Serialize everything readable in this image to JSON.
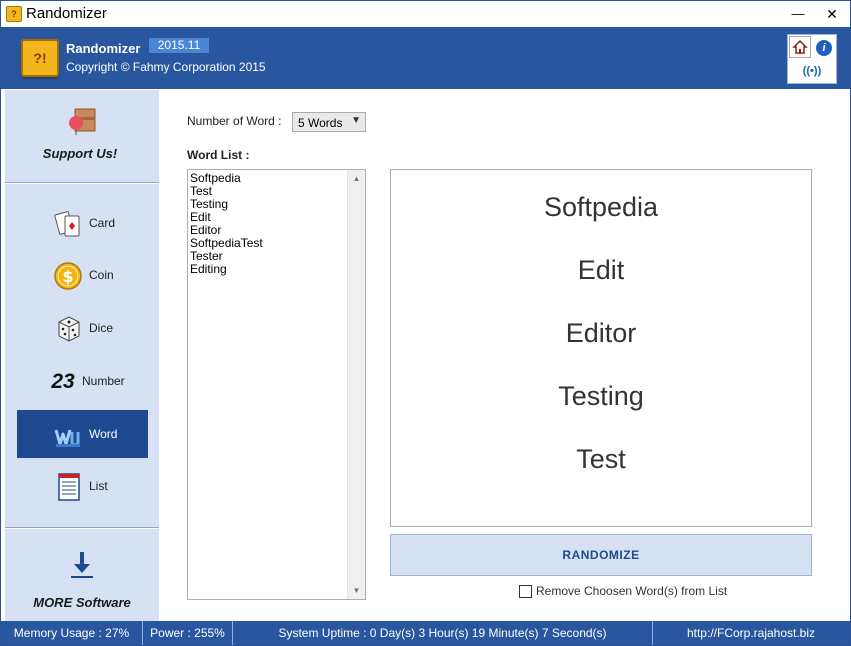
{
  "window": {
    "title": "Randomizer",
    "minimize_glyph": "—",
    "close_glyph": "✕"
  },
  "header": {
    "app_name": "Randomizer",
    "version": "2015.11",
    "copyright": "Copyright © Fahmy Corporation 2015",
    "home_icon": "home-icon",
    "info_icon": "info-icon",
    "web_icon": "web-icon"
  },
  "sidebar": {
    "support_label": "Support Us!",
    "items": [
      {
        "label": "Card",
        "icon": "card-icon"
      },
      {
        "label": "Coin",
        "icon": "coin-icon"
      },
      {
        "label": "Dice",
        "icon": "dice-icon"
      },
      {
        "label": "Number",
        "icon": "number-icon",
        "glyph": "23"
      },
      {
        "label": "Word",
        "icon": "word-icon",
        "active": true
      },
      {
        "label": "List",
        "icon": "list-icon"
      }
    ],
    "more_label": "MORE Software"
  },
  "main": {
    "number_of_word_label": "Number of Word :",
    "number_of_word_value": "5 Words",
    "word_list_label": "Word List :",
    "word_list": [
      "Softpedia",
      "Test",
      "Testing",
      "Edit",
      "Editor",
      "SoftpediaTest",
      "Tester",
      "Editing"
    ],
    "results": [
      "Softpedia",
      "Edit",
      "Editor",
      "Testing",
      "Test"
    ],
    "randomize_label": "RANDOMIZE",
    "remove_checkbox_label": "Remove Choosen Word(s) from List",
    "remove_checked": false
  },
  "status": {
    "memory": "Memory Usage : 27%",
    "power": "Power : 255%",
    "uptime": "System Uptime : 0 Day(s) 3 Hour(s) 19 Minute(s) 7 Second(s)",
    "url": "http://FCorp.rajahost.biz"
  },
  "colors": {
    "accent": "#29579f",
    "sidebar_bg": "#d6e2f4",
    "active_nav": "#1d4a8e"
  }
}
